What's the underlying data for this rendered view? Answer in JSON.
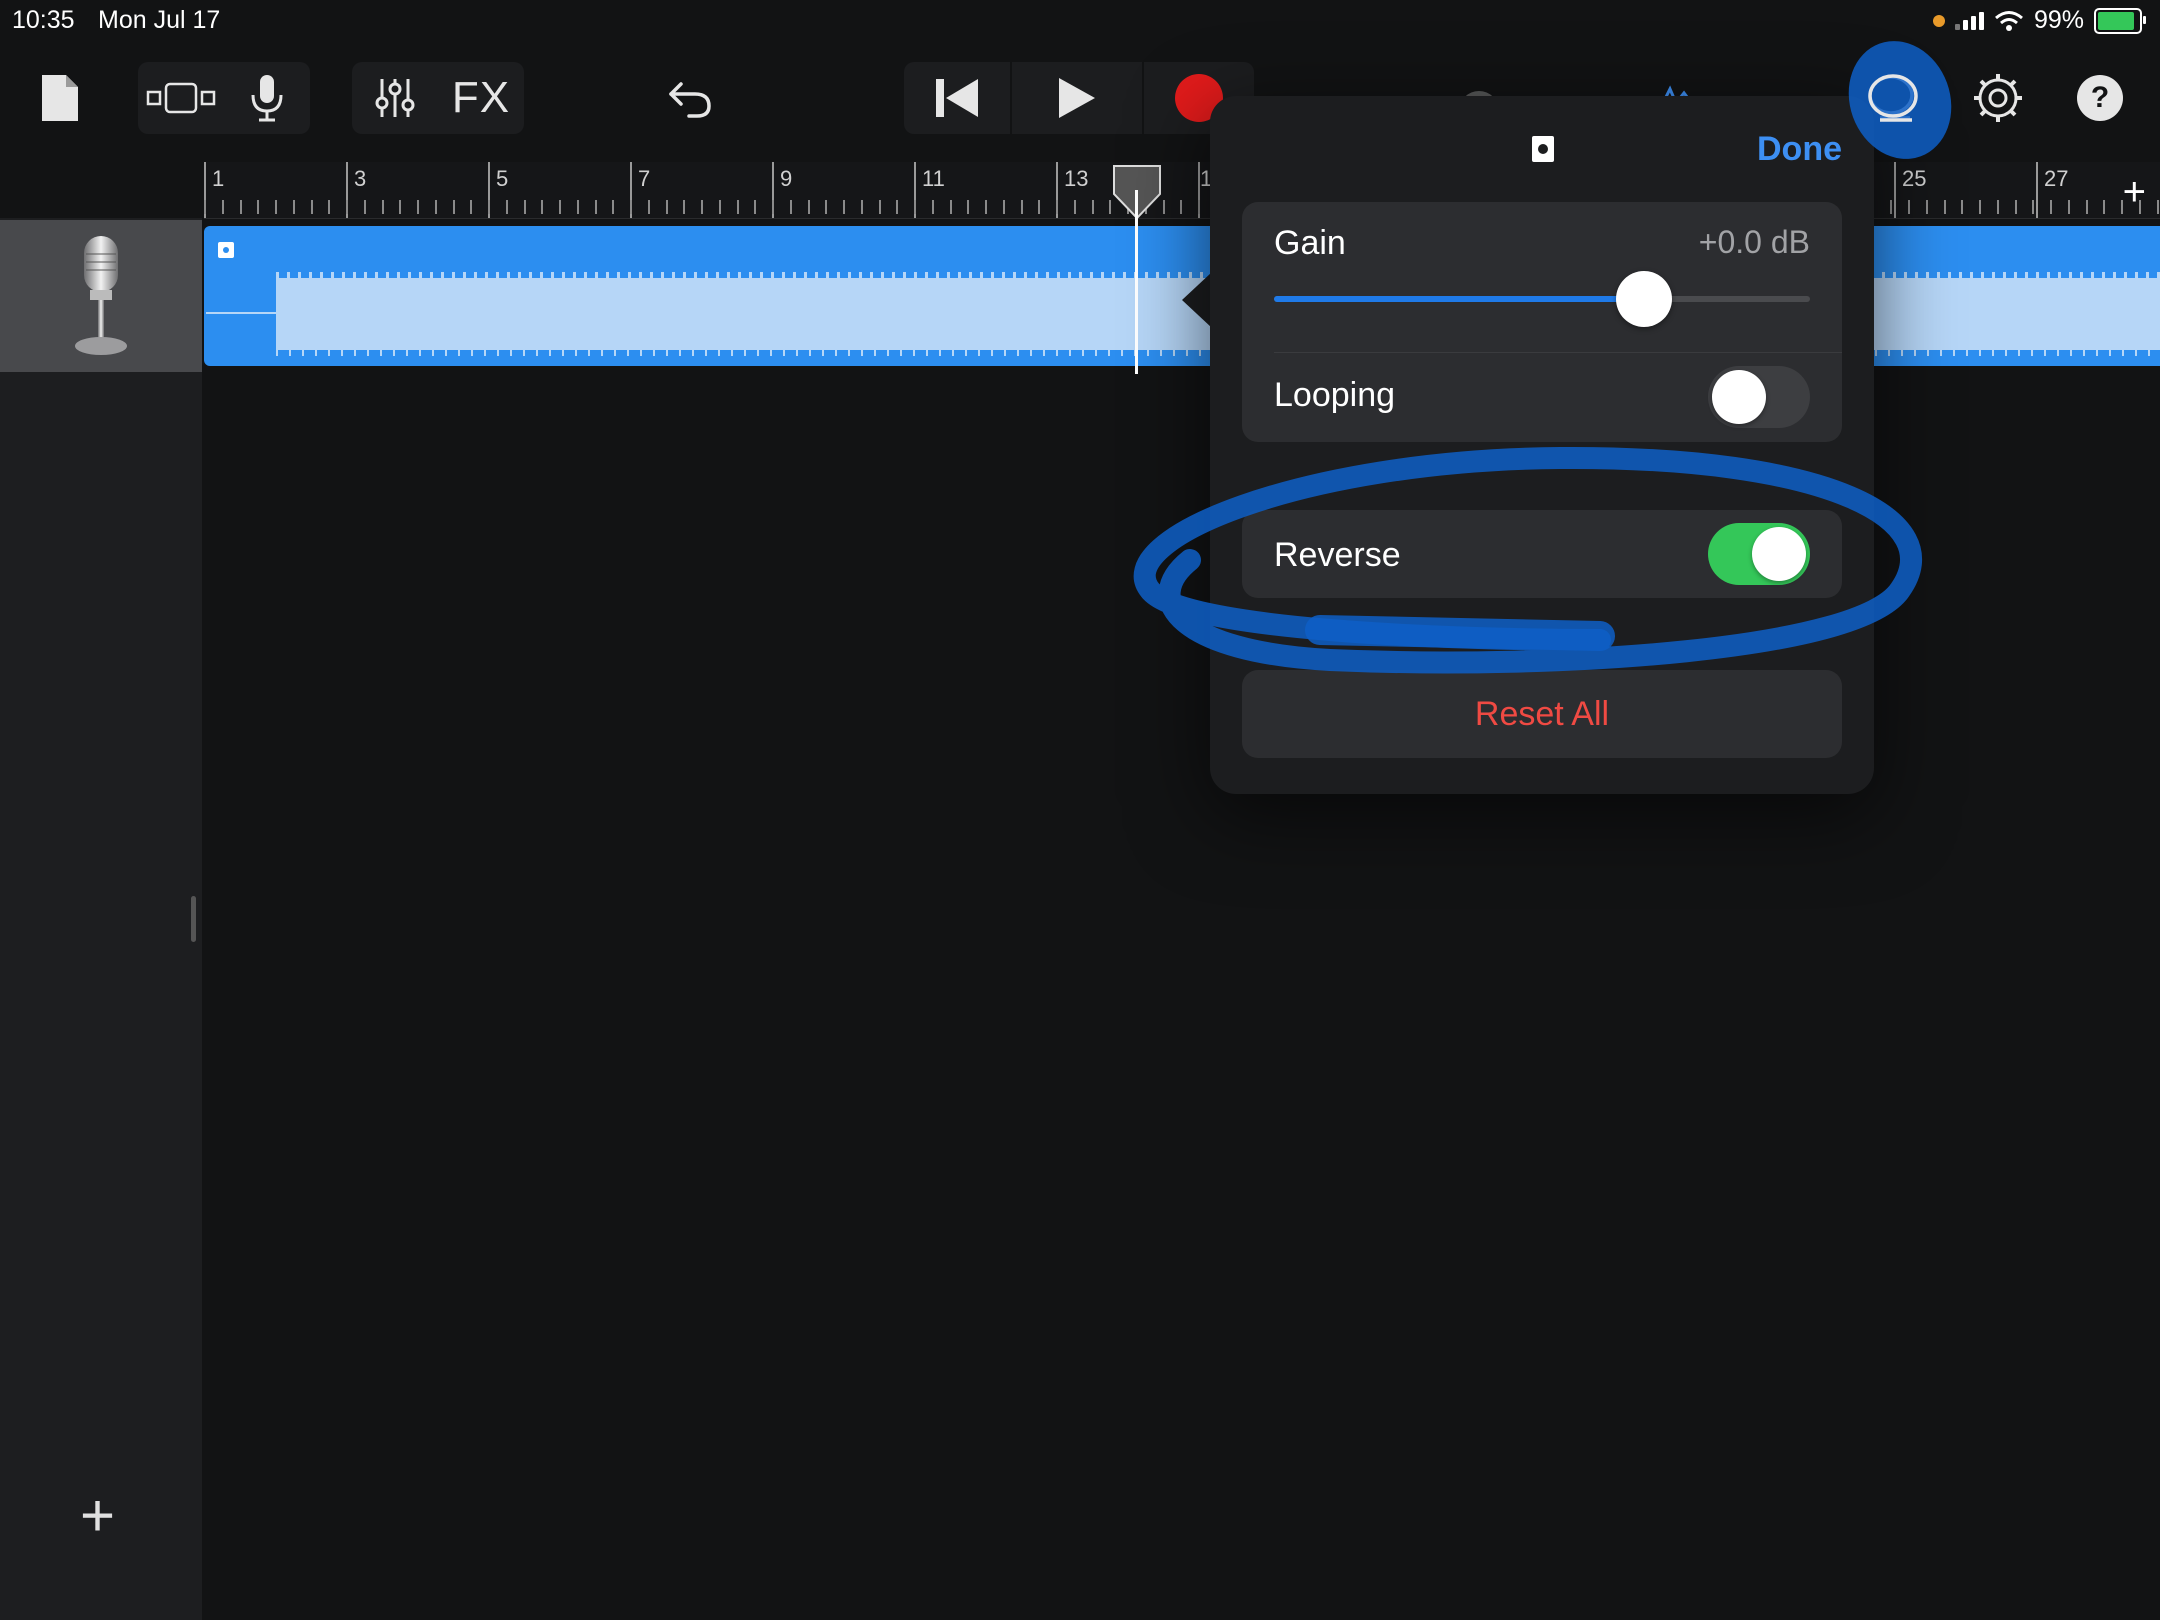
{
  "status_bar": {
    "time": "10:35",
    "date": "Mon Jul 17",
    "battery": "99%"
  },
  "toolbar": {
    "icons": [
      "document-icon",
      "tracks-view-icon",
      "microphone-icon",
      "mixer-icon",
      "fx-button",
      "undo-icon",
      "rewind-icon",
      "play-icon",
      "record-icon",
      "loop-icon",
      "settings-icon",
      "help-icon"
    ],
    "fx_label": "FX",
    "help_label": "?"
  },
  "ruler": {
    "bar_numbers": [
      "1",
      "3",
      "5",
      "7",
      "9",
      "11",
      "13",
      "1",
      "25",
      "27"
    ],
    "add_label": "+"
  },
  "track": {
    "instrument_icon": "microphone-icon",
    "add_track_label": "+"
  },
  "popover": {
    "done_label": "Done",
    "gain": {
      "label": "Gain",
      "value": "+0.0 dB",
      "slider_fraction": 0.69
    },
    "looping": {
      "label": "Looping",
      "on": false
    },
    "reverse": {
      "label": "Reverse",
      "on": true
    },
    "reset_label": "Reset All"
  },
  "colors": {
    "region": "#2c8ef0",
    "waveform": "#b6d6f7",
    "accent": "#3d8ff3",
    "toggle_on": "#34c759",
    "reset": "#f04a43",
    "record": "#e21b1b",
    "annotation": "#0e5fc7"
  }
}
